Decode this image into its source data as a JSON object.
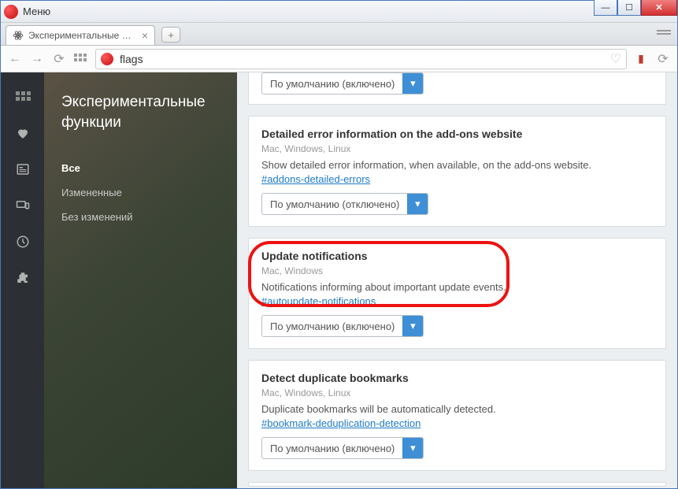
{
  "titlebar": {
    "menu": "Меню"
  },
  "tab": {
    "title": "Экспериментальные фун"
  },
  "url": {
    "value": "flags"
  },
  "sidebar": {
    "heading": "Экспериментальные функции",
    "filters": {
      "all": "Все",
      "changed": "Измененные",
      "unchanged": "Без изменений"
    }
  },
  "flags": {
    "partial": {
      "select": "По умолчанию (включено)"
    },
    "addons": {
      "title": "Detailed error information on the add-ons website",
      "platforms": "Mac, Windows, Linux",
      "desc": "Show detailed error information, when available, on the add-ons website.",
      "hash": "#addons-detailed-errors",
      "select": "По умолчанию (отключено)"
    },
    "update": {
      "title": "Update notifications",
      "platforms": "Mac, Windows",
      "desc": "Notifications informing about important update events.",
      "hash": "#autoupdate-notifications",
      "select": "По умолчанию (включено)"
    },
    "bookmarks": {
      "title": "Detect duplicate bookmarks",
      "platforms": "Mac, Windows, Linux",
      "desc": "Duplicate bookmarks will be automatically detected.",
      "hash": "#bookmark-deduplication-detection",
      "select": "По умолчанию (включено)"
    }
  }
}
